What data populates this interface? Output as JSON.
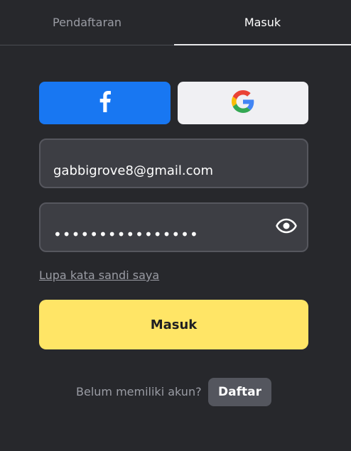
{
  "tabs": {
    "register_label": "Pendaftaran",
    "login_label": "Masuk",
    "active": "login"
  },
  "social": {
    "facebook_icon": "facebook-icon",
    "google_icon": "google-icon",
    "facebook_color": "#1877f2"
  },
  "form": {
    "email_value": "gabbigrove8@gmail.com",
    "password_value": "••••••••••••••••",
    "eye_icon": "eye-icon",
    "forgot_label": "Lupa kata sandi saya",
    "submit_label": "Masuk",
    "submit_color": "#ffe566"
  },
  "signup": {
    "prompt": "Belum memiliki akun?",
    "button_label": "Daftar"
  }
}
